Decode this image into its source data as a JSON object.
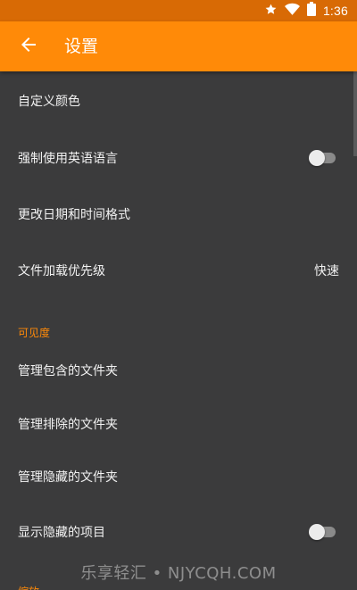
{
  "status_bar": {
    "time": "1:36",
    "icons": [
      "star-icon",
      "wifi-icon",
      "battery-icon"
    ]
  },
  "app_bar": {
    "title": "设置",
    "back_icon": "arrow-left-icon",
    "color": "#ff8a08"
  },
  "settings": {
    "custom_colors": "自定义颜色",
    "force_english": "强制使用英语语言",
    "date_time_format": "更改日期和时间格式",
    "file_loading_priority": "文件加载优先级",
    "file_loading_priority_value": "快速"
  },
  "visibility_section": {
    "header": "可见度",
    "manage_included": "管理包含的文件夹",
    "manage_excluded": "管理排除的文件夹",
    "manage_hidden": "管理隐藏的文件夹",
    "show_hidden_items": "显示隐藏的项目"
  },
  "next_section_partial": "缩放",
  "watermark": "乐享轻汇 • NJYCQH.COM"
}
